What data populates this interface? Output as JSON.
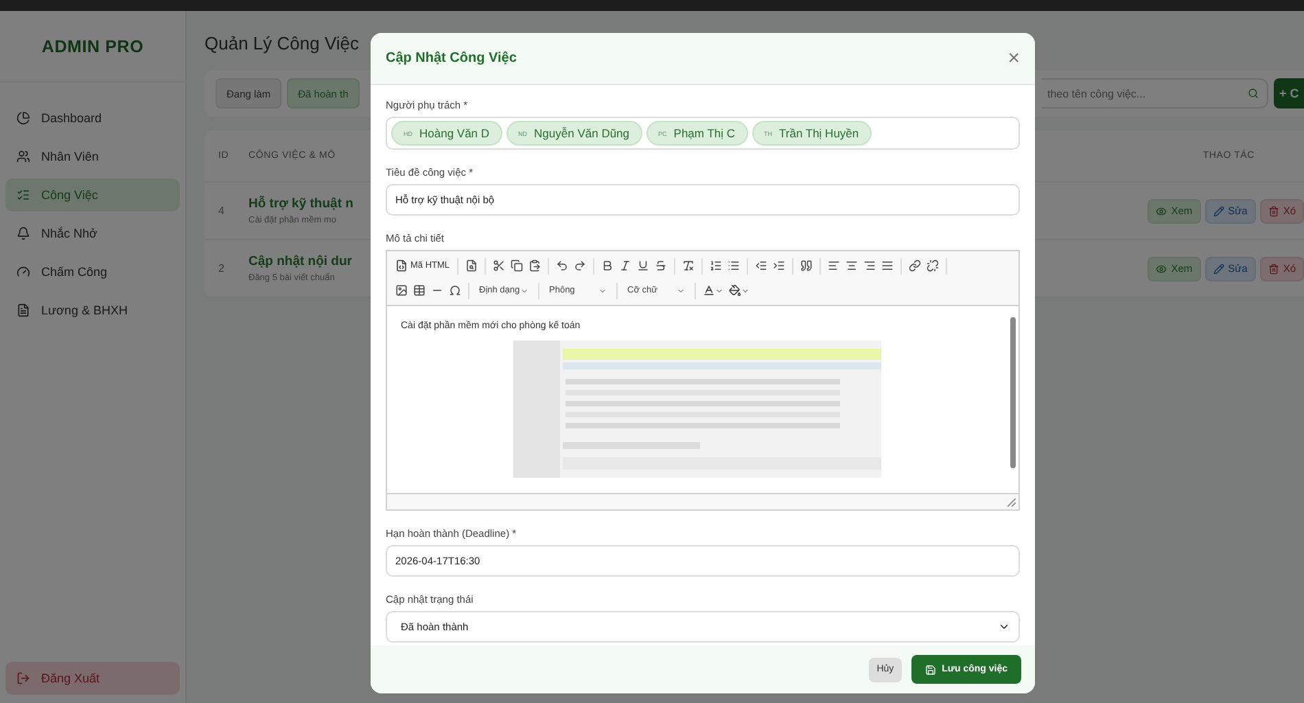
{
  "sidebar": {
    "brand": "ADMIN PRO",
    "items": [
      {
        "label": "Dashboard",
        "selected": false
      },
      {
        "label": "Nhân Viên",
        "selected": false
      },
      {
        "label": "Công Việc",
        "selected": true
      },
      {
        "label": "Nhắc Nhở",
        "selected": false
      },
      {
        "label": "Chấm Công",
        "selected": false
      },
      {
        "label": "Lương & BHXH",
        "selected": false
      }
    ],
    "logout": "Đăng Xuất"
  },
  "page": {
    "title": "Quản Lý Công Việc",
    "filters": [
      {
        "label": "Đang làm",
        "selected": false
      },
      {
        "label": "Đã hoàn th",
        "selected": true
      }
    ],
    "search": {
      "placeholder": "theo tên công việc..."
    },
    "add_button": "+ C"
  },
  "table": {
    "columns": [
      "ID",
      "CÔNG VIỆC & MÔ",
      "THAO TÁC"
    ],
    "rows": [
      {
        "id": "4",
        "title": "Hỗ trợ kỹ thuật n",
        "description": "Cài đặt phần mềm mo",
        "actions": [
          {
            "kind": "view",
            "label": "Xem"
          },
          {
            "kind": "edit",
            "label": "Sửa"
          },
          {
            "kind": "delete",
            "label": "Xó"
          }
        ]
      },
      {
        "id": "2",
        "title": "Cập nhật nội dur",
        "description": "Đăng 5 bài viết chuẩn",
        "actions": [
          {
            "kind": "view",
            "label": "Xem"
          },
          {
            "kind": "edit",
            "label": "Sửa"
          },
          {
            "kind": "delete",
            "label": "Xó"
          }
        ]
      }
    ]
  },
  "modal": {
    "title": "Cập Nhật Công Việc",
    "close": "×",
    "fields": [
      {
        "kind": "chips",
        "label": "Người phụ trách *",
        "chips": [
          {
            "initials": "HD",
            "name": "Hoàng Văn D"
          },
          {
            "initials": "ND",
            "name": "Nguyễn Văn Dũng"
          },
          {
            "initials": "PC",
            "name": "Phạm Thị C"
          },
          {
            "initials": "TH",
            "name": "Trần Thị Huyền"
          }
        ]
      },
      {
        "kind": "text",
        "label": "Tiêu đề công việc *",
        "value": "Hỗ trợ kỹ thuật nội bộ"
      },
      {
        "kind": "editor",
        "label": "Mô tả chi tiết",
        "source_button": "Mã HTML",
        "dropdowns": [
          "Định dạng",
          "Phông",
          "Cỡ chữ"
        ],
        "content": "Cài đặt phần mềm mới cho phòng kế toán"
      },
      {
        "kind": "text",
        "label": "Hạn hoàn thành (Deadline) *",
        "value": "2026-04-17T16:30"
      },
      {
        "kind": "select",
        "label": "Cập nhật trạng thái",
        "value": "Đã hoàn thành"
      }
    ],
    "buttons": [
      {
        "kind": "secondary",
        "label": "Hủy"
      },
      {
        "kind": "primary",
        "label": "Lưu công việc"
      }
    ]
  }
}
